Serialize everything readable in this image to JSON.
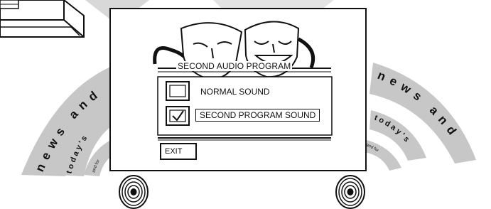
{
  "menu": {
    "title": "SECOND AUDIO PROGRAM",
    "options": [
      {
        "label": "NORMAL SOUND",
        "checked": false
      },
      {
        "label": "SECOND PROGRAM SOUND",
        "checked": true,
        "check_glyph": "✓"
      }
    ],
    "exit_label": "EXIT"
  },
  "decor": {
    "left_arcs": [
      "news and",
      "today's",
      "and for"
    ],
    "right_arcs": [
      "news and",
      "today's",
      "and for"
    ],
    "mask_icon": "theater-masks-icon",
    "speaker_icon": "speaker-grille-icon",
    "remote_icon": "remote-control-icon"
  },
  "colors": {
    "ink": "#111111",
    "arc_fill": "#c7c7c7",
    "background": "#ffffff"
  }
}
